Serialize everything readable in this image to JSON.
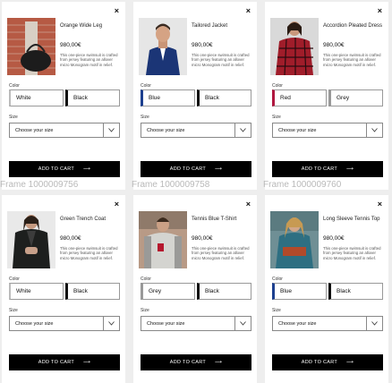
{
  "common": {
    "price": "980,00€",
    "description": "This one-piece swimsuit is crafted from jersey featuring an allover micro Monogram motif in relief.",
    "color_label": "Color",
    "size_label": "Size",
    "size_placeholder": "Choose your size",
    "add_to_cart": "ADD TO CART",
    "close": "×",
    "arrow": "⟶"
  },
  "frames": [
    "Frame 1000009756",
    "Frame 1000009758",
    "Frame 1000009760"
  ],
  "cards": [
    {
      "title": "Orange Wide Leg",
      "colors": [
        "White",
        "Black"
      ]
    },
    {
      "title": "Tailored Jacket",
      "colors": [
        "Blue",
        "Black"
      ]
    },
    {
      "title": "Accordion Pleated Dress",
      "colors": [
        "Red",
        "Grey"
      ]
    },
    {
      "title": "Green Trench Coat",
      "colors": [
        "White",
        "Black"
      ]
    },
    {
      "title": "Tennis Blue T-Shirt",
      "colors": [
        "Grey",
        "Black"
      ]
    },
    {
      "title": "Long Sleeve Tennis Top",
      "colors": [
        "Blue",
        "Black"
      ]
    }
  ]
}
